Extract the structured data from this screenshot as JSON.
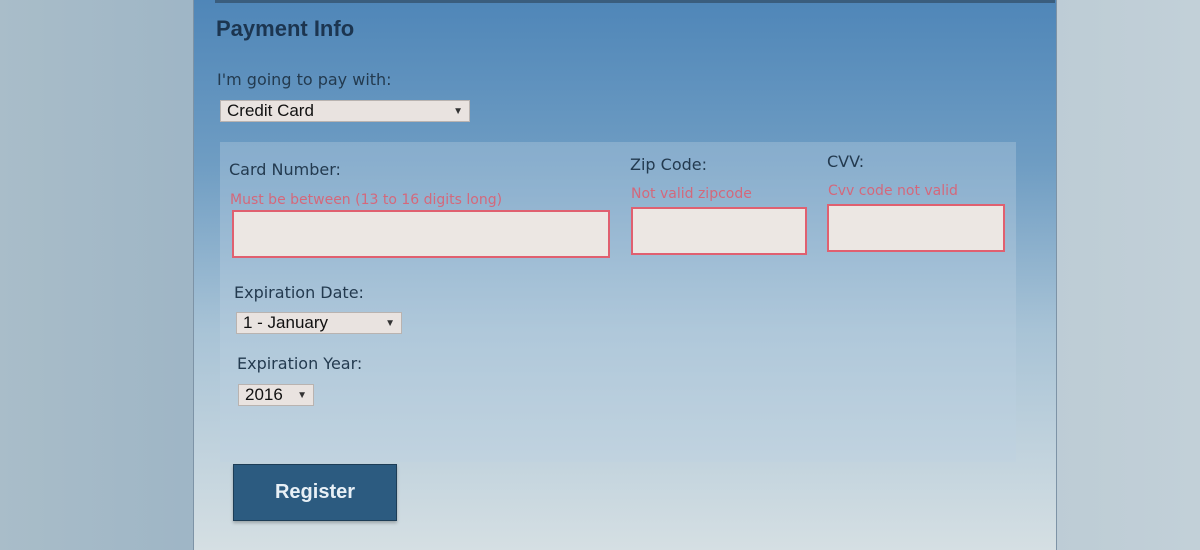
{
  "section_title": "Payment Info",
  "payment": {
    "label": "I'm going to pay with:",
    "selected": "Credit Card"
  },
  "card_number": {
    "label": "Card Number:",
    "error": "Must be between (13 to 16 digits long)",
    "value": ""
  },
  "zip": {
    "label": "Zip Code:",
    "error": "Not valid zipcode",
    "value": ""
  },
  "cvv": {
    "label": "CVV:",
    "error": "Cvv code not valid",
    "value": ""
  },
  "exp_date": {
    "label": "Expiration Date:",
    "selected": "1 - January"
  },
  "exp_year": {
    "label": "Expiration Year:",
    "selected": "2016"
  },
  "register_label": "Register",
  "icons": {
    "dropdown": "chevron-down-icon"
  },
  "colors": {
    "error": "#e05b6d",
    "button": "#2c5b80",
    "panel_top": "#4f86b8"
  }
}
